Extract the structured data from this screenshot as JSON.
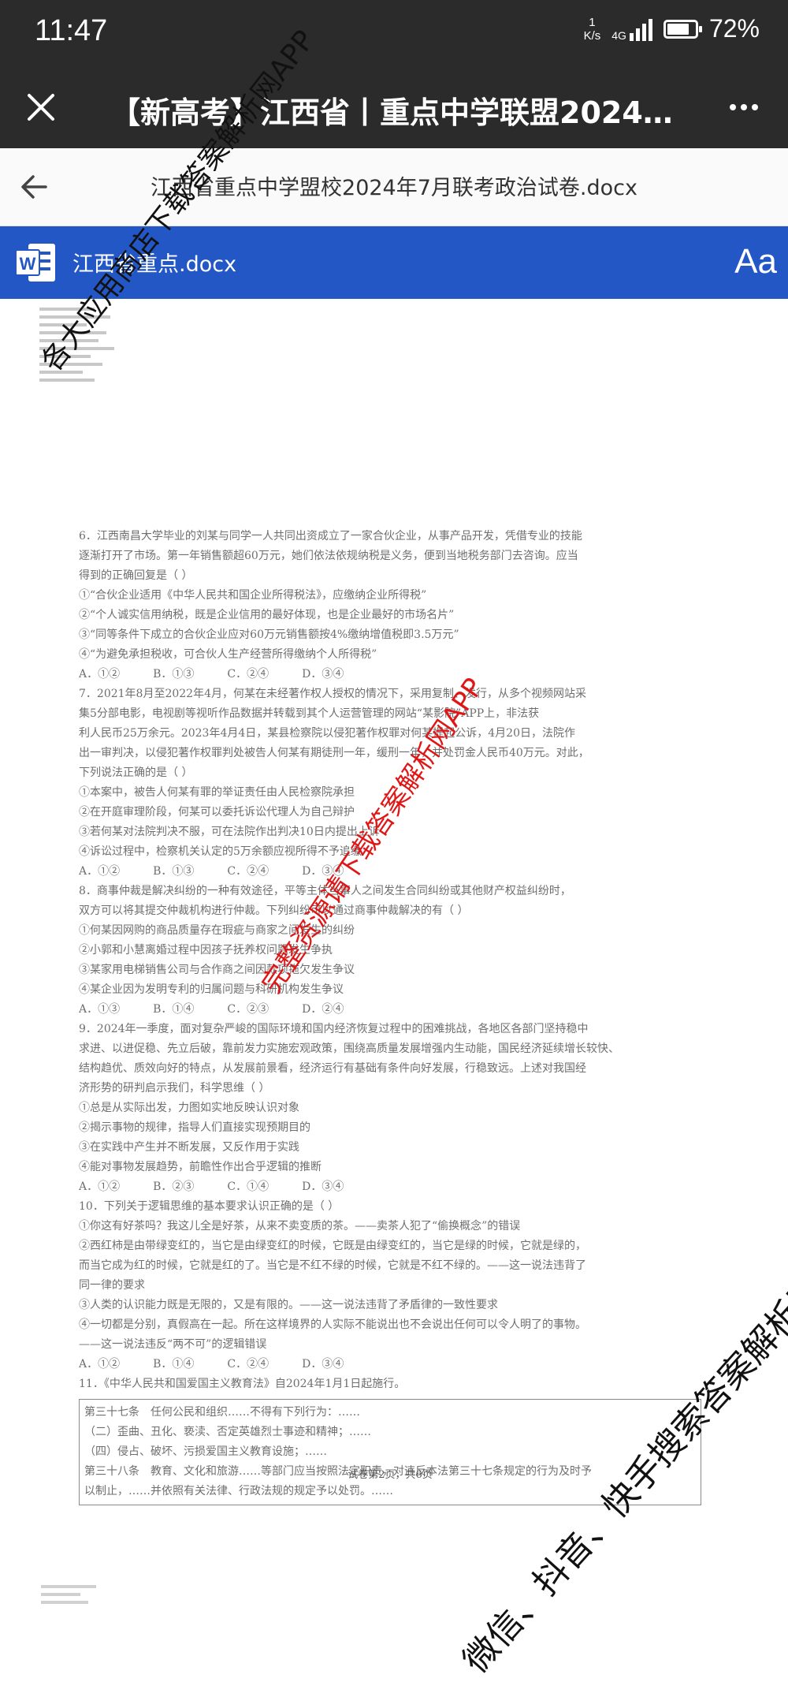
{
  "status_bar": {
    "time": "11:47",
    "net_speed_value": "1",
    "net_speed_unit": "K/s",
    "network": "4G",
    "battery_percent": "72%",
    "battery_level": 0.72
  },
  "title_bar": {
    "title": "【新高考】江西省丨重点中学联盟2024-…"
  },
  "file_bar": {
    "file_title": "江西省重点中学盟校2024年7月联考政治试卷.docx"
  },
  "word_bar": {
    "doc_name": "江西省重点.docx",
    "font_button": "Aa"
  },
  "watermarks": {
    "left": "各大应用商店下载答案解析网APP",
    "center": "完整资源请下载答案解析网APP",
    "bottom": "微信、抖音、快手搜索答案解析网"
  },
  "document": {
    "lines": [
      "6．江西南昌大学毕业的刘某与同学一人共同出资成立了一家合伙企业，从事产品开发，凭借专业的技能",
      "逐渐打开了市场。第一年销售额超60万元，她们依法依规纳税是义务，便到当地税务部门去咨询。应当",
      "得到的正确回复是（    ）",
      "①“合伙企业适用《中华人民共和国企业所得税法》，应缴纳企业所得税”",
      "②“个人诚实信用纳税，既是企业信用的最好体现，也是企业最好的市场名片”",
      "③“同等条件下成立的合伙企业应对60万元销售额按4%缴纳增值税即3.5万元”",
      "④“为避免承担税收，可合伙人生产经营所得缴纳个人所得税”",
      "A．①②　　　B．①③　　　C．②④　　　D．③④",
      "7．2021年8月至2022年4月，何某在未经著作权人授权的情况下，采用复制、发行，从多个视频网站采",
      "集5分部电影，电视剧等视听作品数据并转载到其个人运营管理的网站“某影院”APP上，非法获",
      "利人民币25万余元。2023年4月4日，某县检察院以侵犯著作权罪对何某提起公诉，4月20日，法院作",
      "出一审判决，以侵犯著作权罪判处被告人何某有期徒刑一年，缓刑一年，并处罚金人民币40万元。对此，",
      "下列说法正确的是（    ）",
      "①本案中，被告人何某有罪的举证责任由人民检察院承担",
      "②在开庭审理阶段，何某可以委托诉讼代理人为自己辩护",
      "③若何某对法院判决不服，可在法院作出判决10日内提出上诉",
      "④诉讼过程中，检察机关认定的5万余额应视所得不予追缴",
      "A．①②　　　B．①③　　　C．②④　　　D．③④",
      "8．商事仲裁是解决纠纷的一种有效途径，平等主体当事人之间发生合同纠纷或其他财产权益纠纷时，",
      "双方可以将其提交仲裁机构进行仲裁。下列纠纷可以通过商事仲裁解决的有（    ）",
      "①何某因网购的商品质量存在瑕疵与商家之间发生的纠纷",
      "②小郭和小慧离婚过程中因孩子抚养权问题发生争执",
      "③某家用电梯销售公司与合作商之间因款项拖欠发生争议",
      "④某企业因为发明专利的归属问题与科研机构发生争议",
      "A．①③　　　B．①④　　　C．②③　　　D．②④",
      "9．2024年一季度，面对复杂严峻的国际环境和国内经济恢复过程中的困难挑战，各地区各部门坚持稳中",
      "求进、以进促稳、先立后破，靠前发力实施宏观政策，围绕高质量发展增强内生动能，国民经济延续增长较快、",
      "结构趋优、质效向好的特点，从发展前景看，经济运行有基础有条件向好发展，行稳致远。上述对我国经",
      "济形势的研判启示我们，科学思维（    ）",
      "①总是从实际出发，力图如实地反映认识对象",
      "②揭示事物的规律，指导人们直接实现预期目的",
      "③在实践中产生并不断发展，又反作用于实践",
      "④能对事物发展趋势，前瞻性作出合乎逻辑的推断",
      "A．①②　　　B．②③　　　C．①④　　　D．③④",
      "10．下列关于逻辑思维的基本要求认识正确的是（    ）",
      "①你这有好茶吗？我这儿全是好茶，从来不卖变质的茶。——卖茶人犯了“偷换概念”的错误",
      "②西红柿是由带绿变红的，当它是由绿变红的时候，它既是由绿变红的，当它是绿的时候，它就是绿的，",
      "而当它成为红的时候，它就是红的了。当它是不红不绿的时候，它就是不红不绿的。——这一说法违背了",
      "同一律的要求",
      "③人类的认识能力既是无限的，又是有限的。——这一说法违背了矛盾律的一致性要求",
      "④一切都是分别，真假高在一起。所在这样境界的人实际不能说出也不会说出任何可以令人明了的事物。",
      "——这一说法违反“两不可”的逻辑错误",
      "A．①②　　　B．①④　　　C．②④　　　D．③④",
      "11．《中华人民共和国爱国主义教育法》自2024年1月1日起施行。"
    ],
    "box_lines": [
      "第三十七条　任何公民和组织……不得有下列行为：……",
      "（二）歪曲、丑化、亵渎、否定英雄烈士事迹和精神；……",
      "（四）侵占、破坏、污损爱国主义教育设施；……",
      "第三十八条　教育、文化和旅游……等部门应当按照法定职责，对违反本法第三十七条规定的行为及时予",
      "以制止，……并依照有关法律、行政法规的规定予以处罚。……"
    ],
    "footer": "试卷第2页，共6页"
  }
}
